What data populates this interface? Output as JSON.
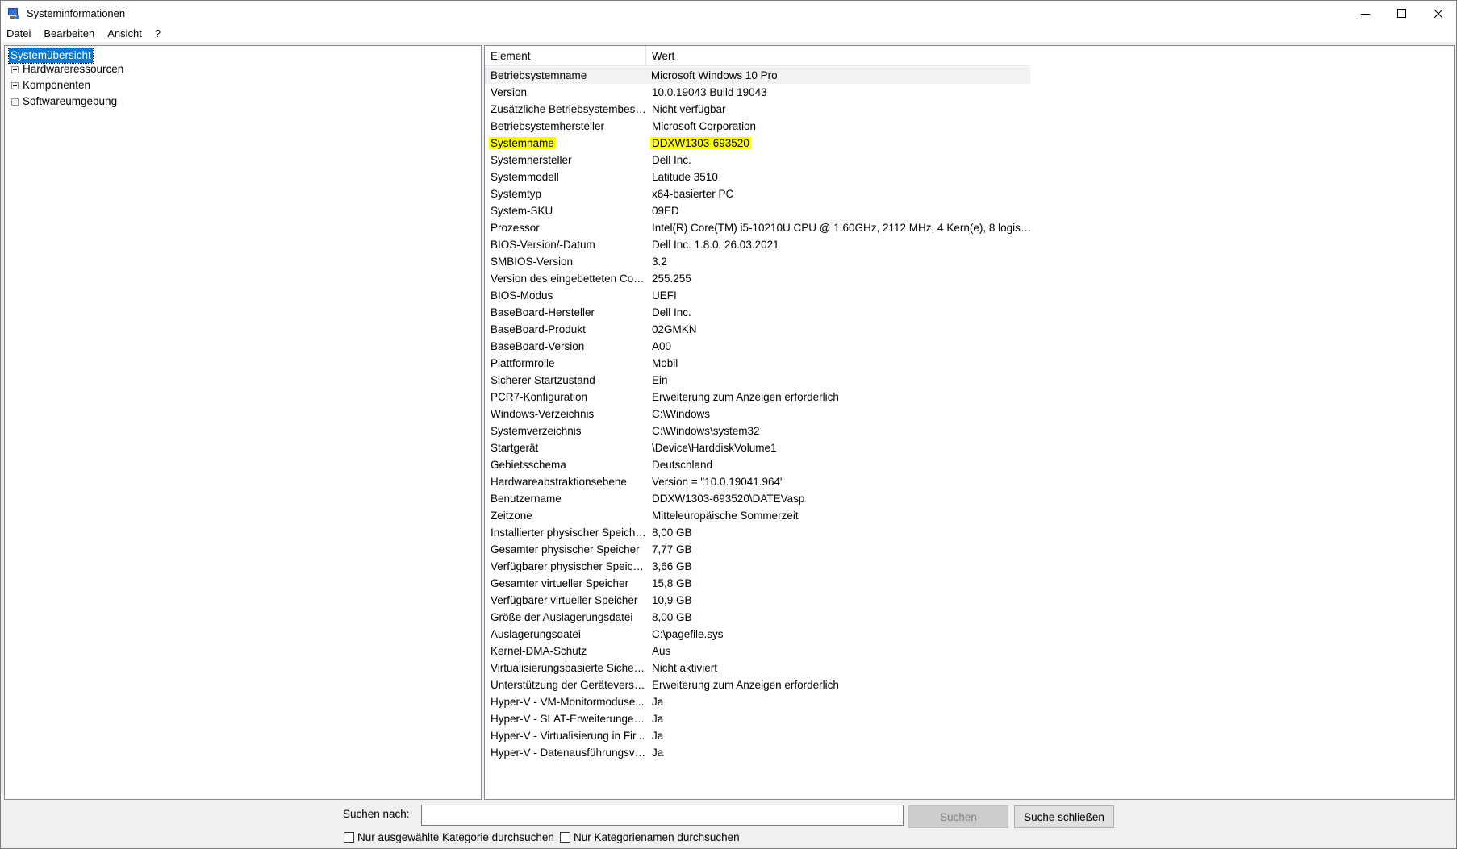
{
  "window": {
    "title": "Systeminformationen",
    "controls": {
      "minimize": "minimize",
      "maximize": "maximize",
      "close": "close"
    }
  },
  "menu": [
    "Datei",
    "Bearbeiten",
    "Ansicht",
    "?"
  ],
  "tree": {
    "root": "Systemübersicht",
    "children": [
      "Hardwareressourcen",
      "Komponenten",
      "Softwareumgebung"
    ]
  },
  "list": {
    "headers": {
      "element": "Element",
      "value": "Wert"
    },
    "highlight_color": "#ffff00",
    "rows": [
      [
        "Betriebsystemname",
        "Microsoft Windows 10 Pro"
      ],
      [
        "Version",
        "10.0.19043 Build 19043"
      ],
      [
        "Zusätzliche Betriebsystembesch...",
        "Nicht verfügbar"
      ],
      [
        "Betriebsystemhersteller",
        "Microsoft Corporation"
      ],
      [
        "Systemname",
        "DDXW1303-693520"
      ],
      [
        "Systemhersteller",
        "Dell Inc."
      ],
      [
        "Systemmodell",
        "Latitude 3510"
      ],
      [
        "Systemtyp",
        "x64-basierter PC"
      ],
      [
        "System-SKU",
        "09ED"
      ],
      [
        "Prozessor",
        "Intel(R) Core(TM) i5-10210U CPU @ 1.60GHz, 2112 MHz, 4 Kern(e), 8 logische(..."
      ],
      [
        "BIOS-Version/-Datum",
        "Dell Inc. 1.8.0, 26.03.2021"
      ],
      [
        "SMBIOS-Version",
        "3.2"
      ],
      [
        "Version des eingebetteten Cont...",
        "255.255"
      ],
      [
        "BIOS-Modus",
        "UEFI"
      ],
      [
        "BaseBoard-Hersteller",
        "Dell Inc."
      ],
      [
        "BaseBoard-Produkt",
        "02GMKN"
      ],
      [
        "BaseBoard-Version",
        "A00"
      ],
      [
        "Plattformrolle",
        "Mobil"
      ],
      [
        "Sicherer Startzustand",
        "Ein"
      ],
      [
        "PCR7-Konfiguration",
        "Erweiterung zum Anzeigen erforderlich"
      ],
      [
        "Windows-Verzeichnis",
        "C:\\Windows"
      ],
      [
        "Systemverzeichnis",
        "C:\\Windows\\system32"
      ],
      [
        "Startgerät",
        "\\Device\\HarddiskVolume1"
      ],
      [
        "Gebietsschema",
        "Deutschland"
      ],
      [
        "Hardwareabstraktionsebene",
        "Version = \"10.0.19041.964\""
      ],
      [
        "Benutzername",
        "DDXW1303-693520\\DATEVasp"
      ],
      [
        "Zeitzone",
        "Mitteleuropäische Sommerzeit"
      ],
      [
        "Installierter physischer Speicher...",
        "8,00 GB"
      ],
      [
        "Gesamter physischer Speicher",
        "7,77 GB"
      ],
      [
        "Verfügbarer physischer Speicher",
        "3,66 GB"
      ],
      [
        "Gesamter virtueller Speicher",
        "15,8 GB"
      ],
      [
        "Verfügbarer virtueller Speicher",
        "10,9 GB"
      ],
      [
        "Größe der Auslagerungsdatei",
        "8,00 GB"
      ],
      [
        "Auslagerungsdatei",
        "C:\\pagefile.sys"
      ],
      [
        "Kernel-DMA-Schutz",
        "Aus"
      ],
      [
        "Virtualisierungsbasierte Sicherh...",
        "Nicht aktiviert"
      ],
      [
        "Unterstützung der Geräteversc...",
        "Erweiterung zum Anzeigen erforderlich"
      ],
      [
        "Hyper-V - VM-Monitormoduse...",
        "Ja"
      ],
      [
        "Hyper-V - SLAT-Erweiterungen ...",
        "Ja"
      ],
      [
        "Hyper-V - Virtualisierung in Fir...",
        "Ja"
      ],
      [
        "Hyper-V - Datenausführungsve...",
        "Ja"
      ]
    ]
  },
  "search": {
    "label": "Suchen nach:",
    "value": "",
    "search_button": "Suchen",
    "close_button": "Suche schließen",
    "option_selected_category": "Nur ausgewählte Kategorie durchsuchen",
    "option_category_names": "Nur Kategorienamen durchsuchen"
  }
}
